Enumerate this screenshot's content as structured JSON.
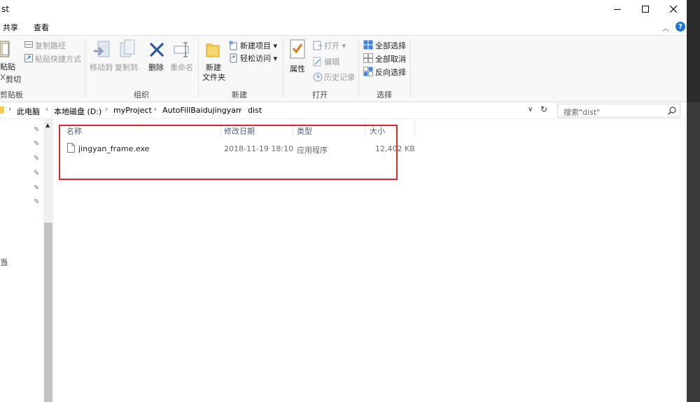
{
  "window": {
    "title": "st"
  },
  "menu_tabs": {
    "share": "共享",
    "view": "查看"
  },
  "ribbon": {
    "clipboard": {
      "copy_path": "复制路径",
      "paste_shortcut": "粘贴快捷方式",
      "paste": "粘贴",
      "cut": "剪切",
      "label": "剪贴板"
    },
    "organize": {
      "move_to": "移动到",
      "copy_to": "复制到",
      "delete": "删除",
      "rename": "重命名",
      "label": "组织"
    },
    "new": {
      "new_item": "新建项目 ▾",
      "easy_access": "轻松访问 ▾",
      "new_folder_line1": "新建",
      "new_folder_line2": "文件夹",
      "label": "新建"
    },
    "open": {
      "properties": "属性",
      "open": "打开 ▾",
      "edit": "编辑",
      "history": "历史记录",
      "label": "打开"
    },
    "select": {
      "select_all": "全部选择",
      "select_none": "全部取消",
      "invert": "反向选择",
      "label": "选择"
    }
  },
  "address": {
    "crumbs": [
      "此电脑",
      "本地磁盘 (D:)",
      "myProject",
      "AutoFillBaidujingyan",
      "dist"
    ],
    "search_placeholder": "搜索\"dist\""
  },
  "nav": {
    "partial_label": "当"
  },
  "columns": {
    "name": "名称",
    "date": "修改日期",
    "type": "类型",
    "size": "大小"
  },
  "files": [
    {
      "name": "jingyan_frame.exe",
      "date": "2018-11-19 18:10",
      "type": "应用程序",
      "size": "12,402 KB"
    }
  ],
  "colors": {
    "highlight_box": "#e0262b",
    "accent": "#1e73d6"
  }
}
